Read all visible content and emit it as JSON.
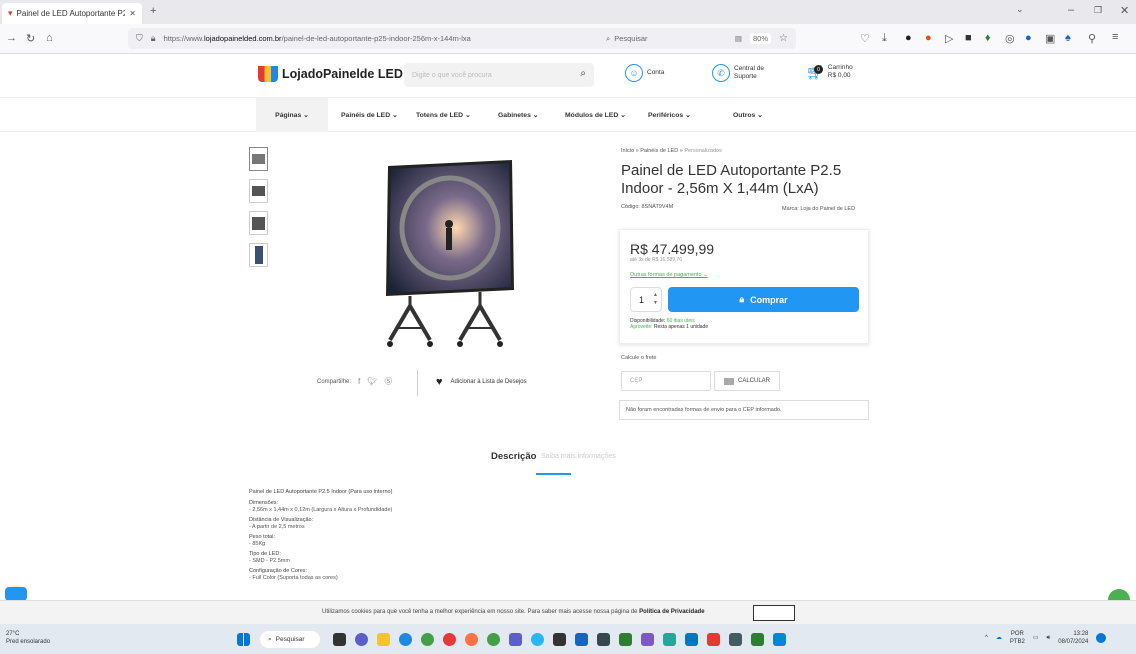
{
  "browser": {
    "tab_title": "Painel de LED Autoportante P2",
    "url_prefix": "https://www.",
    "url_domain": "lojadopainelded.com.br",
    "url_path": "/painel-de-led-autoportante-p25-indoor-256m-x-144m-lxa",
    "zoom": "80%",
    "search_placeholder": "Pesquisar"
  },
  "header": {
    "logo_text": "LojadoPainelde LED",
    "search_placeholder": "Digite o que você procura",
    "account_label": "Conta",
    "support_line1": "Central de",
    "support_line2": "Suporte",
    "cart_label": "Carrinho",
    "cart_total": "R$ 0,00",
    "cart_count": "0"
  },
  "menu": {
    "items": [
      {
        "label": "Páginas ⌄"
      },
      {
        "label": "Painéis de LED ⌄"
      },
      {
        "label": "Totens de LED ⌄"
      },
      {
        "label": "Gabinetes ⌄"
      },
      {
        "label": "Módulos de LED ⌄"
      },
      {
        "label": "Periféricos ⌄"
      },
      {
        "label": "Outros ⌄"
      }
    ]
  },
  "product": {
    "breadcrumb_home": "Início",
    "breadcrumb_cat": "Painéis de LED",
    "breadcrumb_current": "Personalizados",
    "title": "Painel de LED Autoportante P2.5 Indoor - 2,56m X 1,44m (LxA)",
    "code": "Código: 8SNAT9V4M",
    "brand": "Marca: Loja do Painel de LED",
    "price": "R$ 47.499,99",
    "installments": "até 3x de R$ 16.589,76",
    "other_payments": "Outras formas de pagamento ⌄",
    "quantity": "1",
    "buy_label": "Comprar",
    "availability_label": "Disponibilidade:",
    "availability_value": "60 dias úteis",
    "hurry_label": "Aproveite:",
    "hurry_value": "Resta apenas 1 unidade",
    "shipping_label": "Calcule o frete",
    "cep_placeholder": "CEP",
    "calc_label": "CALCULAR",
    "no_shipping": "Não foram encontradas formas de envio para o CEP informado.",
    "share_label": "Compartilhe:",
    "wishlist_label": "Adicionar à Lista de Desejos"
  },
  "description": {
    "tab_label": "Descrição",
    "tab_more": "Saiba mais informações",
    "title": "Painel de LED Autoportante P2.5 Indoor (Para uso interno)",
    "sections": [
      {
        "heading": "Dimensões:",
        "value": "- 2,56m x 1,44m x 0,12m (Largura x Altura x Profundidade)"
      },
      {
        "heading": "Distância de Visualização:",
        "value": "- A partir de 2,5 metros"
      },
      {
        "heading": "Peso total:",
        "value": "- 85Kg"
      },
      {
        "heading": "Tipo de LED:",
        "value": "- SMD - P2.5mm"
      },
      {
        "heading": "Configuração de Cores:",
        "value": "- Full Color (Suporta todas as cores)"
      }
    ]
  },
  "cookie": {
    "text": "Utilizamos cookies para que você tenha a melhor experiência em nosso site. Para saber mais acesse nossa página de ",
    "link": "Política de Privacidade"
  },
  "taskbar": {
    "temp": "27°C",
    "weather": "Pred ensolarado",
    "search": "Pesquisar",
    "lang1": "POR",
    "lang2": "PTB2",
    "time": "13:28",
    "date": "08/07/2024"
  }
}
